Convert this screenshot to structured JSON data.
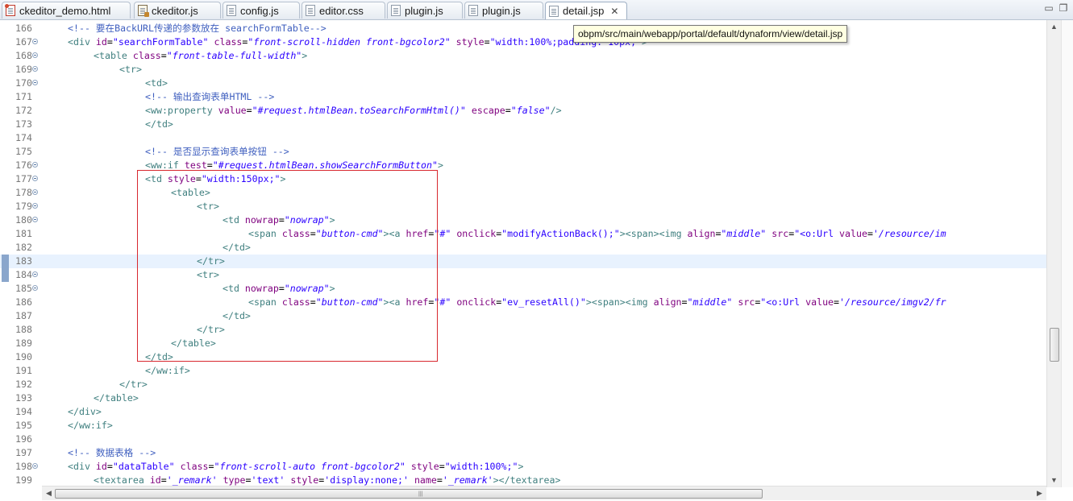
{
  "tabs": [
    {
      "label": "ckeditor_demo.html",
      "icon": "html-file-icon",
      "active": false
    },
    {
      "label": "ckeditor.js",
      "icon": "js-file-icon",
      "active": false
    },
    {
      "label": "config.js",
      "icon": "text-file-icon",
      "active": false
    },
    {
      "label": "editor.css",
      "icon": "text-file-icon",
      "active": false
    },
    {
      "label": "plugin.js",
      "icon": "text-file-icon",
      "active": false
    },
    {
      "label": "plugin.js",
      "icon": "text-file-icon",
      "active": false
    },
    {
      "label": "detail.jsp",
      "icon": "jsp-file-icon",
      "active": true
    }
  ],
  "active_tab_close": "✕",
  "window_controls": {
    "minimize": "▭",
    "maximize": "❐"
  },
  "tooltip": "obpm/src/main/webapp/portal/default/dynaform/view/detail.jsp",
  "scrollbar": {
    "grip": "|||",
    "up": "▲",
    "down": "▼",
    "left": "◀",
    "right": "▶"
  },
  "current_line": 183,
  "lines": [
    {
      "n": "166",
      "fold": false,
      "segs": [
        [
          "cm",
          "<!-- 要在BackURL传递的参数放在 searchFormTable-->"
        ]
      ],
      "indent": 1
    },
    {
      "n": "167",
      "fold": true,
      "segs": [
        [
          "tag",
          "<div "
        ],
        [
          "attr",
          "id"
        ],
        [
          "txt",
          "="
        ],
        [
          "valn",
          "\"searchFormTable\""
        ],
        [
          "tag",
          " "
        ],
        [
          "attr",
          "class"
        ],
        [
          "txt",
          "="
        ],
        [
          "val",
          "\"front-scroll-hidden front-bgcolor2\""
        ],
        [
          "tag",
          " "
        ],
        [
          "attr",
          "style"
        ],
        [
          "txt",
          "="
        ],
        [
          "valn",
          "\"width:100%;padding: 10px;\""
        ],
        [
          "tag",
          ">"
        ]
      ],
      "indent": 1
    },
    {
      "n": "168",
      "fold": true,
      "segs": [
        [
          "tag",
          "<table "
        ],
        [
          "attr",
          "class"
        ],
        [
          "txt",
          "="
        ],
        [
          "val",
          "\"front-table-full-width\""
        ],
        [
          "tag",
          ">"
        ]
      ],
      "indent": 2
    },
    {
      "n": "169",
      "fold": true,
      "segs": [
        [
          "tag",
          "<tr>"
        ]
      ],
      "indent": 3
    },
    {
      "n": "170",
      "fold": true,
      "segs": [
        [
          "tag",
          "<td>"
        ]
      ],
      "indent": 4
    },
    {
      "n": "171",
      "fold": false,
      "segs": [
        [
          "cm",
          "<!-- 输出查询表单HTML -->"
        ]
      ],
      "indent": 4
    },
    {
      "n": "172",
      "fold": false,
      "segs": [
        [
          "tag",
          "<ww:property "
        ],
        [
          "attr",
          "value"
        ],
        [
          "txt",
          "="
        ],
        [
          "val",
          "\"#request.htmlBean.toSearchFormHtml()\""
        ],
        [
          "tag",
          " "
        ],
        [
          "attr",
          "escape"
        ],
        [
          "txt",
          "="
        ],
        [
          "val",
          "\"false\""
        ],
        [
          "tag",
          "/>"
        ]
      ],
      "indent": 4
    },
    {
      "n": "173",
      "fold": false,
      "segs": [
        [
          "tag",
          "</td>"
        ]
      ],
      "indent": 4
    },
    {
      "n": "174",
      "fold": false,
      "segs": [],
      "indent": 0
    },
    {
      "n": "175",
      "fold": false,
      "segs": [
        [
          "cm",
          "<!-- 是否显示查询表单按钮 -->"
        ]
      ],
      "indent": 4
    },
    {
      "n": "176",
      "fold": true,
      "segs": [
        [
          "tag",
          "<ww:if "
        ],
        [
          "attr",
          "test"
        ],
        [
          "txt",
          "="
        ],
        [
          "val",
          "\"#request.htmlBean.showSearchFormButton\""
        ],
        [
          "tag",
          ">"
        ]
      ],
      "indent": 4
    },
    {
      "n": "177",
      "fold": true,
      "segs": [
        [
          "tag",
          "<td "
        ],
        [
          "attr",
          "style"
        ],
        [
          "txt",
          "="
        ],
        [
          "valn",
          "\"width:150px;\""
        ],
        [
          "tag",
          ">"
        ]
      ],
      "indent": 4
    },
    {
      "n": "178",
      "fold": true,
      "segs": [
        [
          "tag",
          "<table>"
        ]
      ],
      "indent": 5
    },
    {
      "n": "179",
      "fold": true,
      "segs": [
        [
          "tag",
          "<tr>"
        ]
      ],
      "indent": 6
    },
    {
      "n": "180",
      "fold": true,
      "segs": [
        [
          "tag",
          "<td "
        ],
        [
          "attr",
          "nowrap"
        ],
        [
          "txt",
          "="
        ],
        [
          "val",
          "\"nowrap\""
        ],
        [
          "tag",
          ">"
        ]
      ],
      "indent": 7
    },
    {
      "n": "181",
      "fold": false,
      "segs": [
        [
          "tag",
          "<span "
        ],
        [
          "attr",
          "class"
        ],
        [
          "txt",
          "="
        ],
        [
          "val",
          "\"button-cmd\""
        ],
        [
          "tag",
          "><a "
        ],
        [
          "attr",
          "href"
        ],
        [
          "txt",
          "="
        ],
        [
          "valn",
          "\"#\""
        ],
        [
          "tag",
          " "
        ],
        [
          "attr",
          "onclick"
        ],
        [
          "txt",
          "="
        ],
        [
          "valn",
          "\"modifyActionBack();\""
        ],
        [
          "tag",
          "><span><img "
        ],
        [
          "attr",
          "align"
        ],
        [
          "txt",
          "="
        ],
        [
          "val",
          "\"middle\""
        ],
        [
          "tag",
          " "
        ],
        [
          "attr",
          "src"
        ],
        [
          "txt",
          "="
        ],
        [
          "valn",
          "\"<o:Url "
        ],
        [
          "attr",
          "value"
        ],
        [
          "txt",
          "="
        ],
        [
          "val",
          "'/resource/im"
        ]
      ],
      "indent": 8
    },
    {
      "n": "182",
      "fold": false,
      "segs": [
        [
          "tag",
          "</td>"
        ]
      ],
      "indent": 7
    },
    {
      "n": "183",
      "fold": false,
      "segs": [
        [
          "tag",
          "</tr>"
        ]
      ],
      "indent": 6
    },
    {
      "n": "184",
      "fold": true,
      "segs": [
        [
          "tag",
          "<tr>"
        ]
      ],
      "indent": 6
    },
    {
      "n": "185",
      "fold": true,
      "segs": [
        [
          "tag",
          "<td "
        ],
        [
          "attr",
          "nowrap"
        ],
        [
          "txt",
          "="
        ],
        [
          "val",
          "\"nowrap\""
        ],
        [
          "tag",
          ">"
        ]
      ],
      "indent": 7
    },
    {
      "n": "186",
      "fold": false,
      "segs": [
        [
          "tag",
          "<span "
        ],
        [
          "attr",
          "class"
        ],
        [
          "txt",
          "="
        ],
        [
          "val",
          "\"button-cmd\""
        ],
        [
          "tag",
          "><a "
        ],
        [
          "attr",
          "href"
        ],
        [
          "txt",
          "="
        ],
        [
          "valn",
          "\"#\""
        ],
        [
          "tag",
          " "
        ],
        [
          "attr",
          "onclick"
        ],
        [
          "txt",
          "="
        ],
        [
          "valn",
          "\"ev_resetAll()\""
        ],
        [
          "tag",
          "><span><img "
        ],
        [
          "attr",
          "align"
        ],
        [
          "txt",
          "="
        ],
        [
          "val",
          "\"middle\""
        ],
        [
          "tag",
          " "
        ],
        [
          "attr",
          "src"
        ],
        [
          "txt",
          "="
        ],
        [
          "valn",
          "\"<o:Url "
        ],
        [
          "attr",
          "value"
        ],
        [
          "txt",
          "="
        ],
        [
          "val",
          "'/resource/imgv2/fr"
        ]
      ],
      "indent": 8
    },
    {
      "n": "187",
      "fold": false,
      "segs": [
        [
          "tag",
          "</td>"
        ]
      ],
      "indent": 7
    },
    {
      "n": "188",
      "fold": false,
      "segs": [
        [
          "tag",
          "</tr>"
        ]
      ],
      "indent": 6
    },
    {
      "n": "189",
      "fold": false,
      "segs": [
        [
          "tag",
          "</table>"
        ]
      ],
      "indent": 5
    },
    {
      "n": "190",
      "fold": false,
      "segs": [
        [
          "tag",
          "</td>"
        ]
      ],
      "indent": 4
    },
    {
      "n": "191",
      "fold": false,
      "segs": [
        [
          "tag",
          "</ww:if>"
        ]
      ],
      "indent": 4
    },
    {
      "n": "192",
      "fold": false,
      "segs": [
        [
          "tag",
          "</tr>"
        ]
      ],
      "indent": 3
    },
    {
      "n": "193",
      "fold": false,
      "segs": [
        [
          "tag",
          "</table>"
        ]
      ],
      "indent": 2
    },
    {
      "n": "194",
      "fold": false,
      "segs": [
        [
          "tag",
          "</div>"
        ]
      ],
      "indent": 1
    },
    {
      "n": "195",
      "fold": false,
      "segs": [
        [
          "tag",
          "</ww:if>"
        ]
      ],
      "indent": 1
    },
    {
      "n": "196",
      "fold": false,
      "segs": [],
      "indent": 0
    },
    {
      "n": "197",
      "fold": false,
      "segs": [
        [
          "cm",
          "<!-- 数据表格 -->"
        ]
      ],
      "indent": 1
    },
    {
      "n": "198",
      "fold": true,
      "segs": [
        [
          "tag",
          "<div "
        ],
        [
          "attr",
          "id"
        ],
        [
          "txt",
          "="
        ],
        [
          "valn",
          "\"dataTable\""
        ],
        [
          "tag",
          " "
        ],
        [
          "attr",
          "class"
        ],
        [
          "txt",
          "="
        ],
        [
          "val",
          "\"front-scroll-auto front-bgcolor2\""
        ],
        [
          "tag",
          " "
        ],
        [
          "attr",
          "style"
        ],
        [
          "txt",
          "="
        ],
        [
          "valn",
          "\"width:100%;\""
        ],
        [
          "tag",
          ">"
        ]
      ],
      "indent": 1
    },
    {
      "n": "199",
      "fold": false,
      "segs": [
        [
          "tag",
          "<textarea "
        ],
        [
          "attr",
          "id"
        ],
        [
          "txt",
          "="
        ],
        [
          "val",
          "'_remark'"
        ],
        [
          "tag",
          " "
        ],
        [
          "attr",
          "type"
        ],
        [
          "txt",
          "="
        ],
        [
          "valn",
          "'text'"
        ],
        [
          "tag",
          " "
        ],
        [
          "attr",
          "style"
        ],
        [
          "txt",
          "="
        ],
        [
          "valn",
          "'display:none;'"
        ],
        [
          "tag",
          " "
        ],
        [
          "attr",
          "name"
        ],
        [
          "txt",
          "="
        ],
        [
          "val",
          "'_remark'"
        ],
        [
          "tag",
          "></textarea>"
        ]
      ],
      "indent": 2
    }
  ]
}
